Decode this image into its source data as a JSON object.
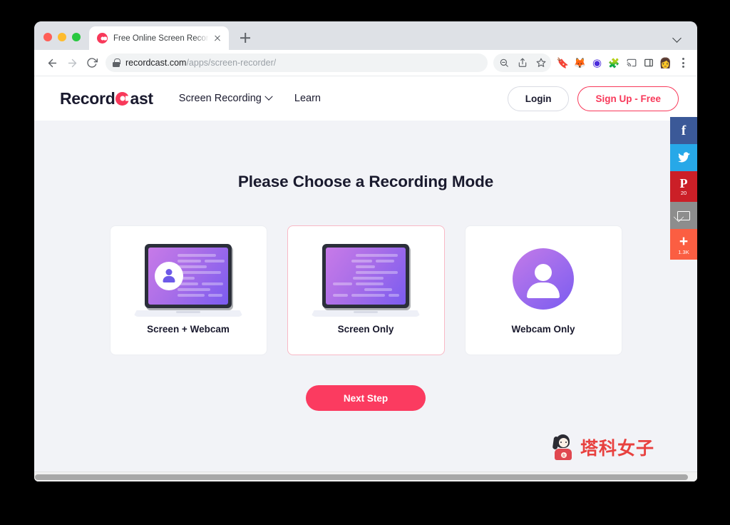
{
  "browser": {
    "tab": {
      "title": "Free Online Screen Recorder -",
      "favicon": "recordcast-c-icon",
      "close_icon": "close-icon"
    },
    "new_tab_icon": "plus-icon",
    "window_chevron_icon": "chevron-down-icon",
    "nav": {
      "back_icon": "back-arrow-icon",
      "forward_icon": "forward-arrow-icon",
      "reload_icon": "reload-icon"
    },
    "omnibox": {
      "lock_icon": "lock-icon",
      "url_domain": "recordcast.com",
      "url_path": "/apps/screen-recorder/",
      "zoom_icon": "zoom-out-icon",
      "share_icon": "share-icon",
      "bookmark_icon": "star-icon"
    },
    "extensions": [
      {
        "name": "honey-extension-icon",
        "glyph": "🔖",
        "color": "#f5a623"
      },
      {
        "name": "metamask-extension-icon",
        "glyph": "🦊",
        "color": "#e2761b"
      },
      {
        "name": "grammarly-extension-icon",
        "glyph": "◉",
        "color": "#4b2ddb"
      },
      {
        "name": "puzzle-extensions-icon",
        "glyph": "🧩",
        "color": "#5f6368"
      },
      {
        "name": "cast-icon",
        "glyph": "⊐",
        "color": "#5f6368"
      },
      {
        "name": "reading-list-icon",
        "glyph": "▣",
        "color": "#5f6368"
      },
      {
        "name": "profile-avatar-icon",
        "glyph": "👩",
        "color": "#c0392b"
      }
    ],
    "menu_icon": "three-dot-menu-icon"
  },
  "site": {
    "logo": {
      "prefix": "Record",
      "icon": "c-target-icon",
      "suffix": "ast"
    },
    "nav": [
      {
        "label": "Screen Recording",
        "has_chevron": true
      },
      {
        "label": "Learn",
        "has_chevron": false
      }
    ],
    "actions": {
      "login": "Login",
      "signup": "Sign Up - Free"
    }
  },
  "main": {
    "title": "Please Choose a Recording Mode",
    "cards": [
      {
        "label": "Screen + Webcam",
        "illustration": "laptop-with-webcam",
        "selected": false
      },
      {
        "label": "Screen Only",
        "illustration": "laptop",
        "selected": true
      },
      {
        "label": "Webcam Only",
        "illustration": "webcam-circle",
        "selected": false
      }
    ],
    "next_button": "Next Step"
  },
  "social_share": [
    {
      "name": "facebook",
      "glyph": "f",
      "count": "",
      "color": "#3b5998"
    },
    {
      "name": "twitter",
      "glyph": "🐦",
      "count": "",
      "color": "#27a8e8"
    },
    {
      "name": "pinterest",
      "glyph": "P",
      "count": "20",
      "color": "#cb1f27"
    },
    {
      "name": "email",
      "glyph": "✉",
      "count": "",
      "color": "#8d8d8d"
    },
    {
      "name": "more",
      "glyph": "+",
      "count": "1.3K",
      "color": "#fb5e42"
    }
  ],
  "watermark": {
    "text": "塔科女子",
    "badge": "女",
    "color": "#e8413f"
  },
  "colors": {
    "accent_pink": "#fb3b60",
    "page_bg": "#f2f3f7",
    "text_dark": "#1a1a2e",
    "purple_start": "#c77ae8",
    "purple_end": "#7b5cf0"
  }
}
